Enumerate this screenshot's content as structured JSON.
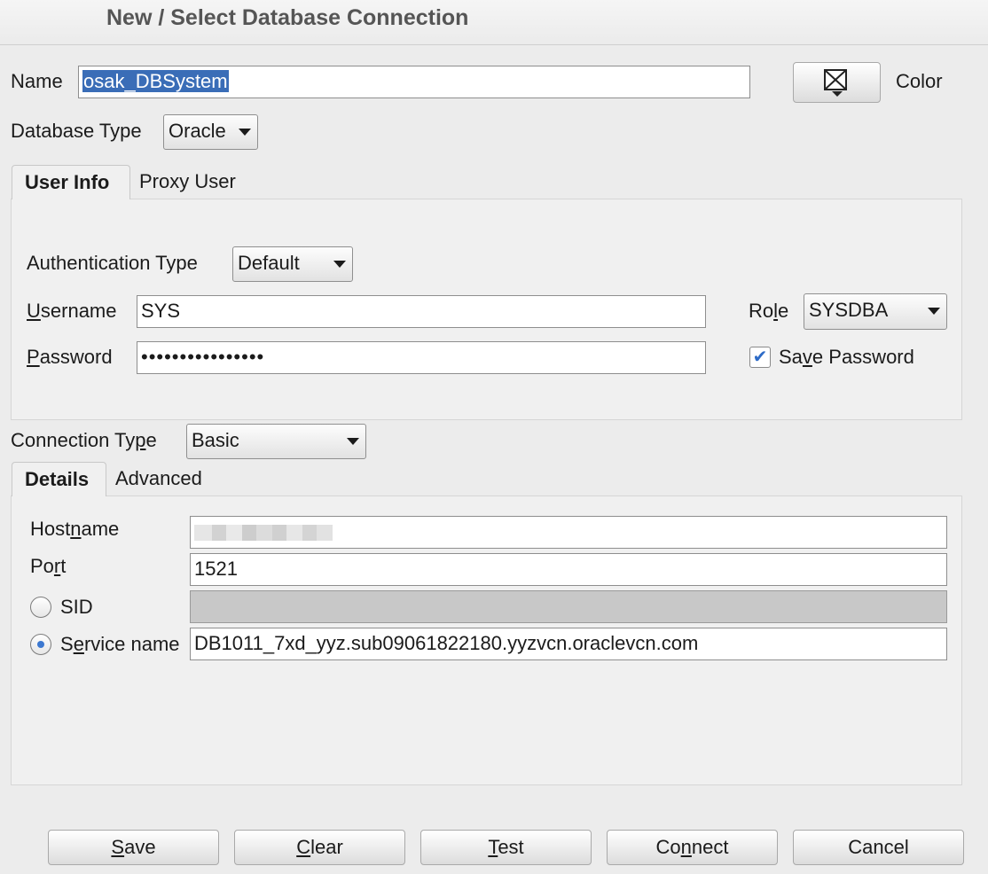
{
  "window": {
    "title": "New / Select Database Connection"
  },
  "name_field": {
    "label": "Name",
    "value": "osak_DBSystem"
  },
  "color": {
    "label": "Color",
    "icon": "color-picker-icon"
  },
  "database_type": {
    "label": "Database Type",
    "value": "Oracle"
  },
  "user_tabs": [
    "User Info",
    "Proxy User"
  ],
  "user_info": {
    "auth_type_label": "Authentication Type",
    "auth_type_value": "Default",
    "username_label": "Username",
    "username_value": "SYS",
    "password_label": "Password",
    "password_value": "••••••••••••••••",
    "role_label": "Role",
    "role_value": "SYSDBA",
    "save_password_label": "Save Password",
    "save_password_checked": true
  },
  "connection_type": {
    "label": "Connection Type",
    "value": "Basic"
  },
  "details_tabs": [
    "Details",
    "Advanced"
  ],
  "details": {
    "hostname_label": "Hostname",
    "hostname_value": "",
    "port_label": "Port",
    "port_value": "1521",
    "sid_label": "SID",
    "sid_value": "",
    "service_name_label": "Service name",
    "service_name_value": "DB1011_7xd_yyz.sub09061822180.yyzvcn.oraclevcn.com",
    "selected_option": "Service name"
  },
  "buttons": {
    "save": "Save",
    "clear": "Clear",
    "test": "Test",
    "connect": "Connect",
    "cancel": "Cancel"
  }
}
